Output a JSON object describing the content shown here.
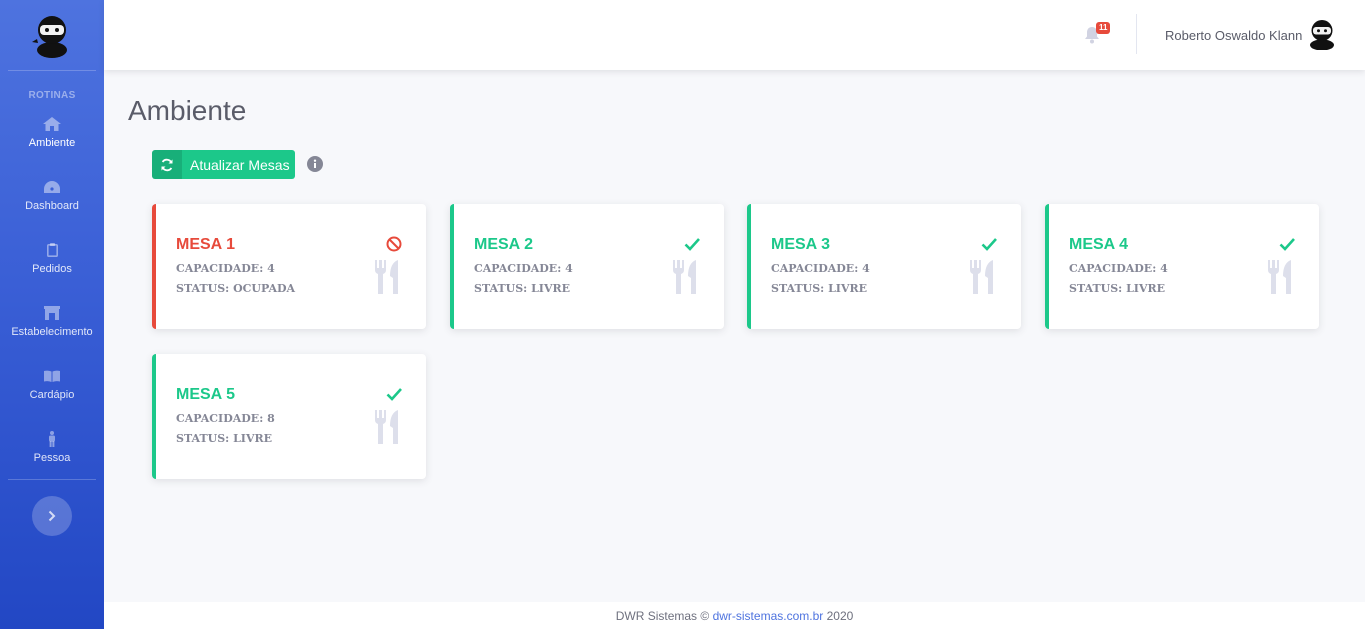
{
  "sidebar": {
    "heading": "ROTINAS",
    "items": [
      {
        "label": "Ambiente",
        "icon": "home-icon"
      },
      {
        "label": "Dashboard",
        "icon": "tachometer-icon"
      },
      {
        "label": "Pedidos",
        "icon": "clipboard-icon"
      },
      {
        "label": "Estabelecimento",
        "icon": "store-icon"
      },
      {
        "label": "Cardápio",
        "icon": "book-icon"
      },
      {
        "label": "Pessoa",
        "icon": "person-icon"
      }
    ]
  },
  "topbar": {
    "notifications_count": "11",
    "user_name": "Roberto Oswaldo Klann"
  },
  "page": {
    "title": "Ambiente",
    "refresh_button": "Atualizar Mesas"
  },
  "mesas": [
    {
      "name": "MESA 1",
      "capacity": "CAPACIDADE: 4",
      "status": "STATUS: OCUPADA",
      "state": "busy"
    },
    {
      "name": "MESA 2",
      "capacity": "CAPACIDADE: 4",
      "status": "STATUS: LIVRE",
      "state": "free"
    },
    {
      "name": "MESA 3",
      "capacity": "CAPACIDADE: 4",
      "status": "STATUS: LIVRE",
      "state": "free"
    },
    {
      "name": "MESA 4",
      "capacity": "CAPACIDADE: 4",
      "status": "STATUS: LIVRE",
      "state": "free"
    },
    {
      "name": "MESA 5",
      "capacity": "CAPACIDADE: 8",
      "status": "STATUS: LIVRE",
      "state": "free"
    }
  ],
  "footer": {
    "prefix": "DWR Sistemas ©",
    "link": "dwr-sistemas.com.br",
    "year": "2020"
  },
  "colors": {
    "primary": "#4e73df",
    "success": "#1cc88a",
    "danger": "#e74a3b"
  }
}
